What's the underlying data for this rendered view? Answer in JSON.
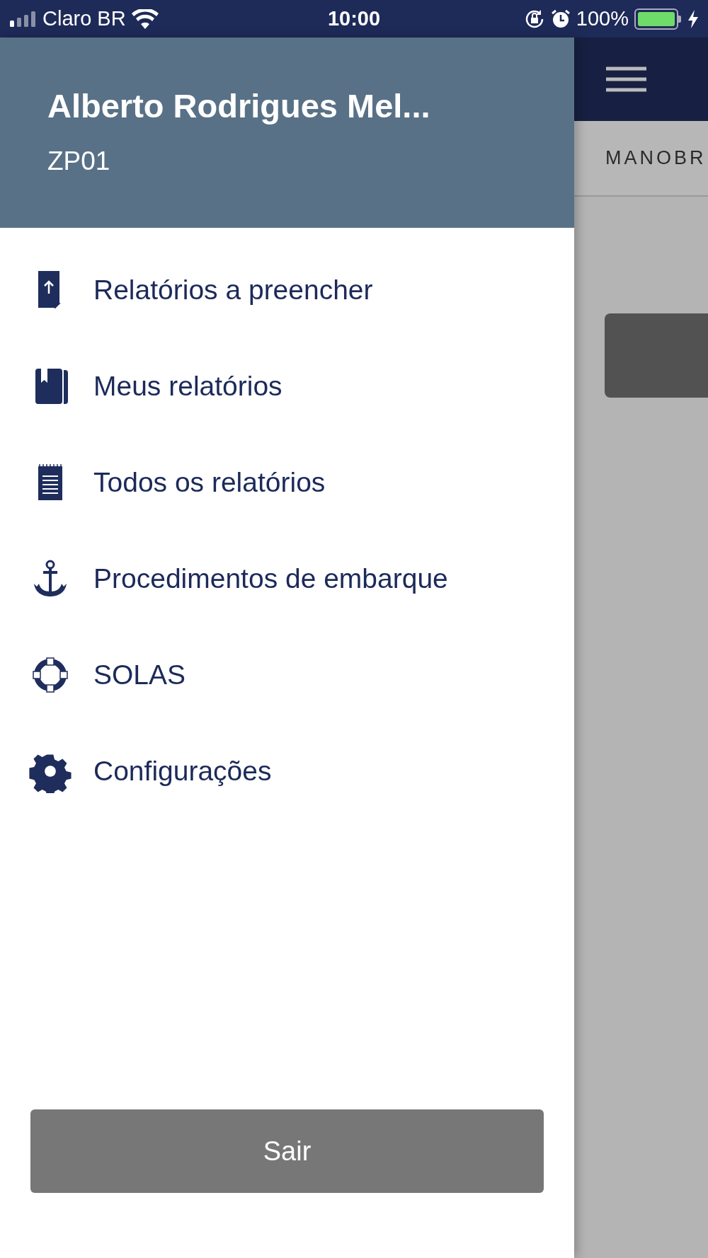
{
  "status_bar": {
    "carrier": "Claro BR",
    "time": "10:00",
    "battery_percent": "100%",
    "battery": {
      "level": 1.0,
      "charging": true
    }
  },
  "drawer": {
    "user_name": "Alberto Rodrigues Mel...",
    "user_code": "ZP01",
    "items": [
      {
        "label": "Relatórios a preencher",
        "kind": "upload"
      },
      {
        "label": "Meus relatórios",
        "kind": "book"
      },
      {
        "label": "Todos os relatórios",
        "kind": "notepad"
      },
      {
        "label": "Procedimentos de embarque",
        "kind": "anchor"
      },
      {
        "label": "SOLAS",
        "kind": "lifebuoy"
      },
      {
        "label": "Configurações",
        "kind": "gear"
      }
    ],
    "logout_button": "Sair"
  },
  "background_screen": {
    "tab_label": "MANOBR"
  }
}
